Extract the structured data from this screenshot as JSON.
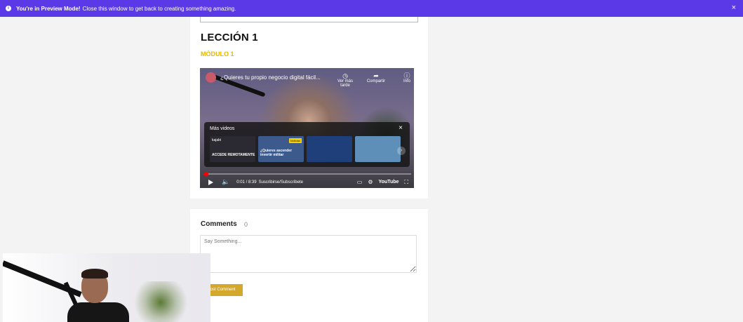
{
  "banner": {
    "bold": "You're in Preview Mode!",
    "text": "Close this window to get back to creating something amazing.",
    "close": "×"
  },
  "lesson": {
    "title": "LECCIÓN 1",
    "module": "MÓDULO 1"
  },
  "video": {
    "title": "¿Quieres tu propio negocio digital fácil...",
    "actions": [
      {
        "icon": "clock-icon",
        "label": "Ver más tarde"
      },
      {
        "icon": "share-icon",
        "label": "Compartir"
      },
      {
        "icon": "info-icon",
        "label": "Info"
      }
    ],
    "more_videos": {
      "title": "Más videos",
      "thumbs": [
        {
          "kicker": "kajabi",
          "text": "ACCEDE REMOTAMENTE",
          "color": "#2b2a33"
        },
        {
          "kicker": "",
          "text": "¿Quieres ascender invertir militar",
          "tag": "Noticias",
          "color": "#3d5a8c"
        },
        {
          "kicker": "",
          "text": "",
          "color": "#1f3f7a"
        },
        {
          "kicker": "",
          "text": "",
          "color": "#5d8fb8"
        }
      ]
    },
    "progress": 0.01,
    "time": "0:01 / 8:39",
    "caption": "Suscribirse/Subscríbete",
    "brand": "YouTube"
  },
  "comments": {
    "title": "Comments",
    "count": "0",
    "placeholder": "Say Something...",
    "button": "Post Comment"
  },
  "colors": {
    "banner": "#5b39e6",
    "accent": "#e6b800",
    "button": "#d4a82a"
  }
}
